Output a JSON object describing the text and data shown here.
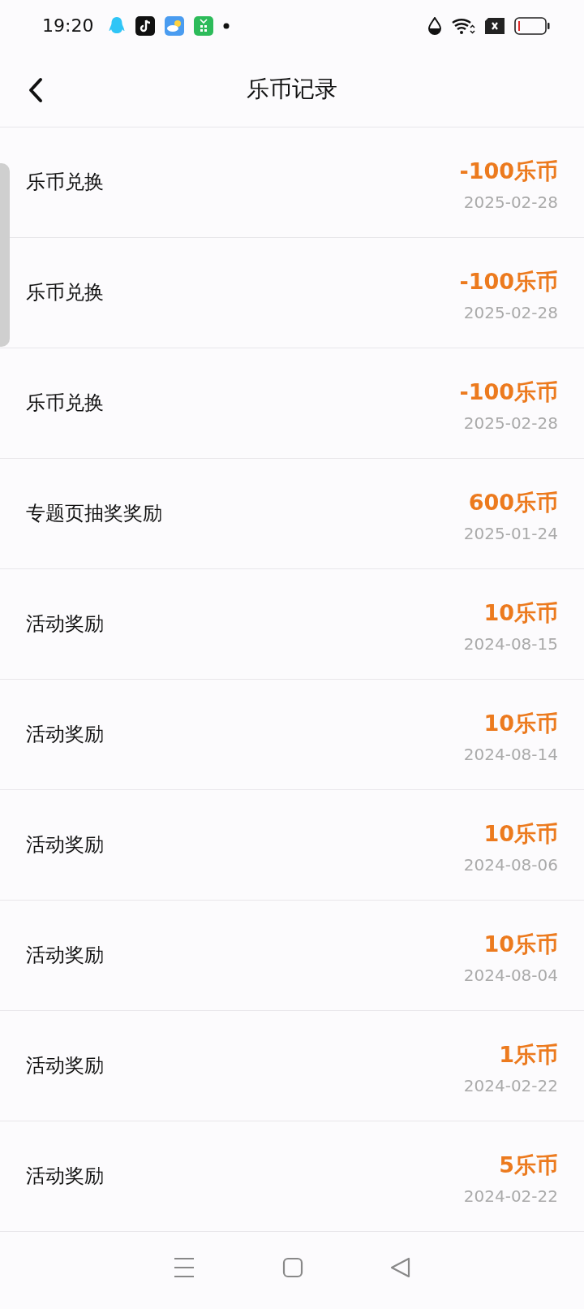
{
  "status_bar": {
    "time": "19:20"
  },
  "header": {
    "title": "乐币记录"
  },
  "records": [
    {
      "title": "乐币兑换",
      "amount": "-100乐币",
      "date": "2025-02-28"
    },
    {
      "title": "乐币兑换",
      "amount": "-100乐币",
      "date": "2025-02-28"
    },
    {
      "title": "乐币兑换",
      "amount": "-100乐币",
      "date": "2025-02-28"
    },
    {
      "title": "专题页抽奖奖励",
      "amount": "600乐币",
      "date": "2025-01-24"
    },
    {
      "title": "活动奖励",
      "amount": "10乐币",
      "date": "2024-08-15"
    },
    {
      "title": "活动奖励",
      "amount": "10乐币",
      "date": "2024-08-14"
    },
    {
      "title": "活动奖励",
      "amount": "10乐币",
      "date": "2024-08-06"
    },
    {
      "title": "活动奖励",
      "amount": "10乐币",
      "date": "2024-08-04"
    },
    {
      "title": "活动奖励",
      "amount": "1乐币",
      "date": "2024-02-22"
    },
    {
      "title": "活动奖励",
      "amount": "5乐币",
      "date": "2024-02-22"
    }
  ]
}
